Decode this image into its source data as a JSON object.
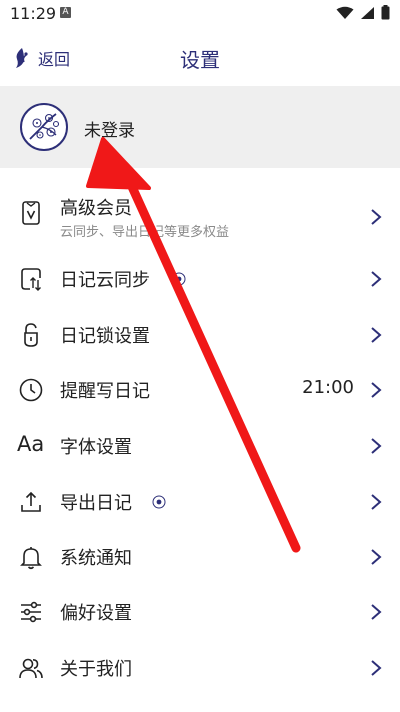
{
  "status_bar": {
    "time": "11:29",
    "notif_letter": "A"
  },
  "nav": {
    "back_label": "返回",
    "title": "设置"
  },
  "account": {
    "label": "未登录"
  },
  "menu": [
    {
      "label": "高级会员",
      "subtitle": "云同步、导出日记等更多权益",
      "icon": "vip-phone-icon"
    },
    {
      "label": "日记云同步",
      "icon": "cloud-sync-icon",
      "badge": true
    },
    {
      "label": "日记锁设置",
      "icon": "lock-icon"
    },
    {
      "label": "提醒写日记",
      "icon": "clock-icon",
      "value": "21:00"
    },
    {
      "label": "字体设置",
      "icon": "font-icon",
      "icon_text": "Aa"
    },
    {
      "label": "导出日记",
      "icon": "export-icon",
      "badge": true
    },
    {
      "label": "系统通知",
      "icon": "bell-icon"
    },
    {
      "label": "偏好设置",
      "icon": "sliders-icon"
    },
    {
      "label": "关于我们",
      "icon": "people-icon"
    }
  ],
  "colors": {
    "accent": "#2d2f78",
    "annotation_arrow": "#f01818",
    "account_bg": "#efefef"
  }
}
